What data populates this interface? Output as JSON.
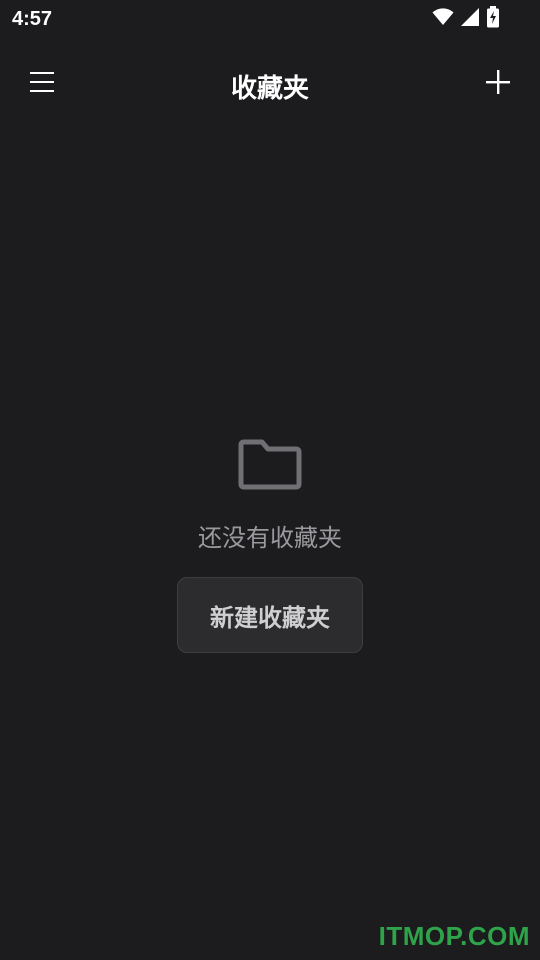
{
  "status_bar": {
    "time": "4:57",
    "icons": [
      "wifi-icon",
      "signal-icon",
      "battery-charging-icon"
    ]
  },
  "app_bar": {
    "title": "收藏夹",
    "left_icon": "menu-icon",
    "right_icon": "plus-icon"
  },
  "empty_state": {
    "icon": "folder-icon",
    "message": "还没有收藏夹",
    "button_label": "新建收藏夹"
  },
  "watermark": {
    "text": "ITMOP.COM"
  },
  "colors": {
    "background": "#1c1c1e",
    "button_background": "#2c2c2e",
    "muted_text": "#9a9a9e",
    "watermark": "#2ea34a"
  }
}
